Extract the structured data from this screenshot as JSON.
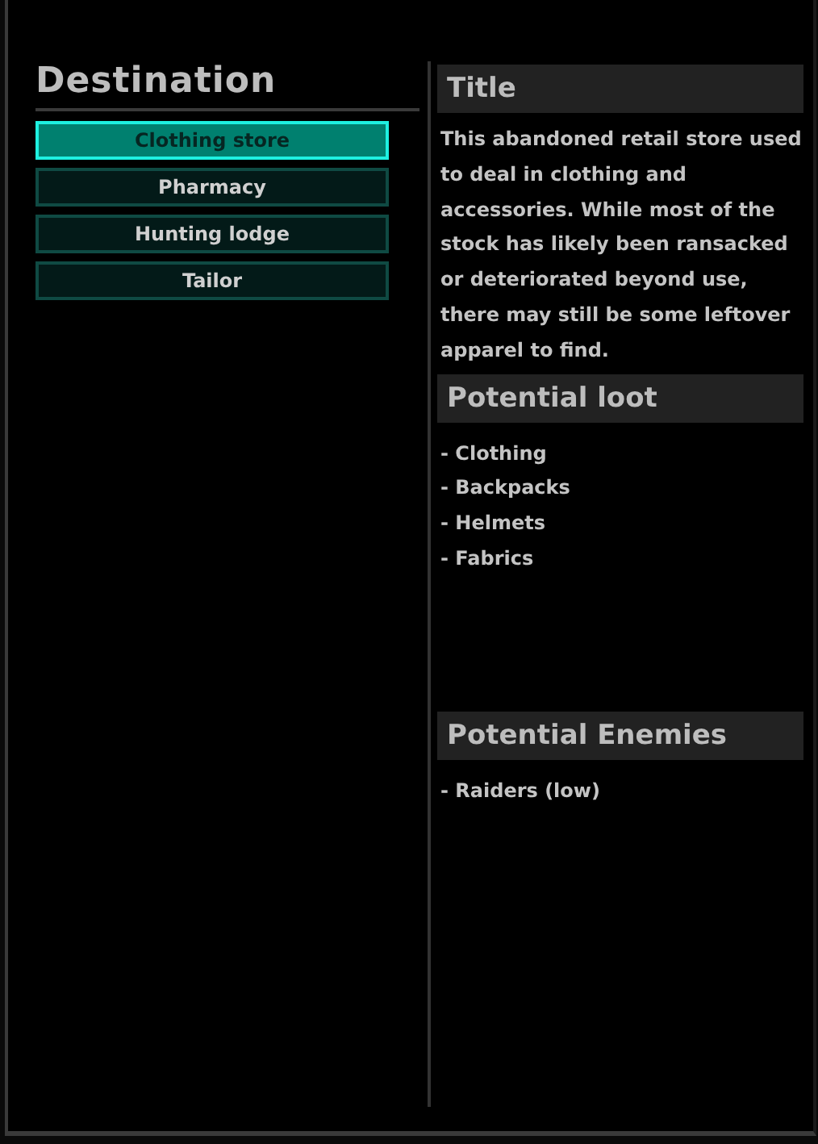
{
  "destination": {
    "title": "Destination",
    "items": [
      {
        "label": "Clothing store",
        "selected": true
      },
      {
        "label": "Pharmacy",
        "selected": false
      },
      {
        "label": "Hunting lodge",
        "selected": false
      },
      {
        "label": "Tailor",
        "selected": false
      }
    ]
  },
  "details": {
    "title": "Title",
    "description": "This abandoned retail store used to deal in clothing and accessories. While most of the stock has likely been ransacked or deteriorated beyond use, there may still be some leftover apparel to find.",
    "loot": {
      "heading": "Potential loot",
      "items": [
        "- Clothing",
        "- Backpacks",
        "- Helmets",
        "- Fabrics"
      ]
    },
    "enemies": {
      "heading": "Potential Enemies",
      "items": [
        "- Raiders (low)"
      ]
    }
  }
}
